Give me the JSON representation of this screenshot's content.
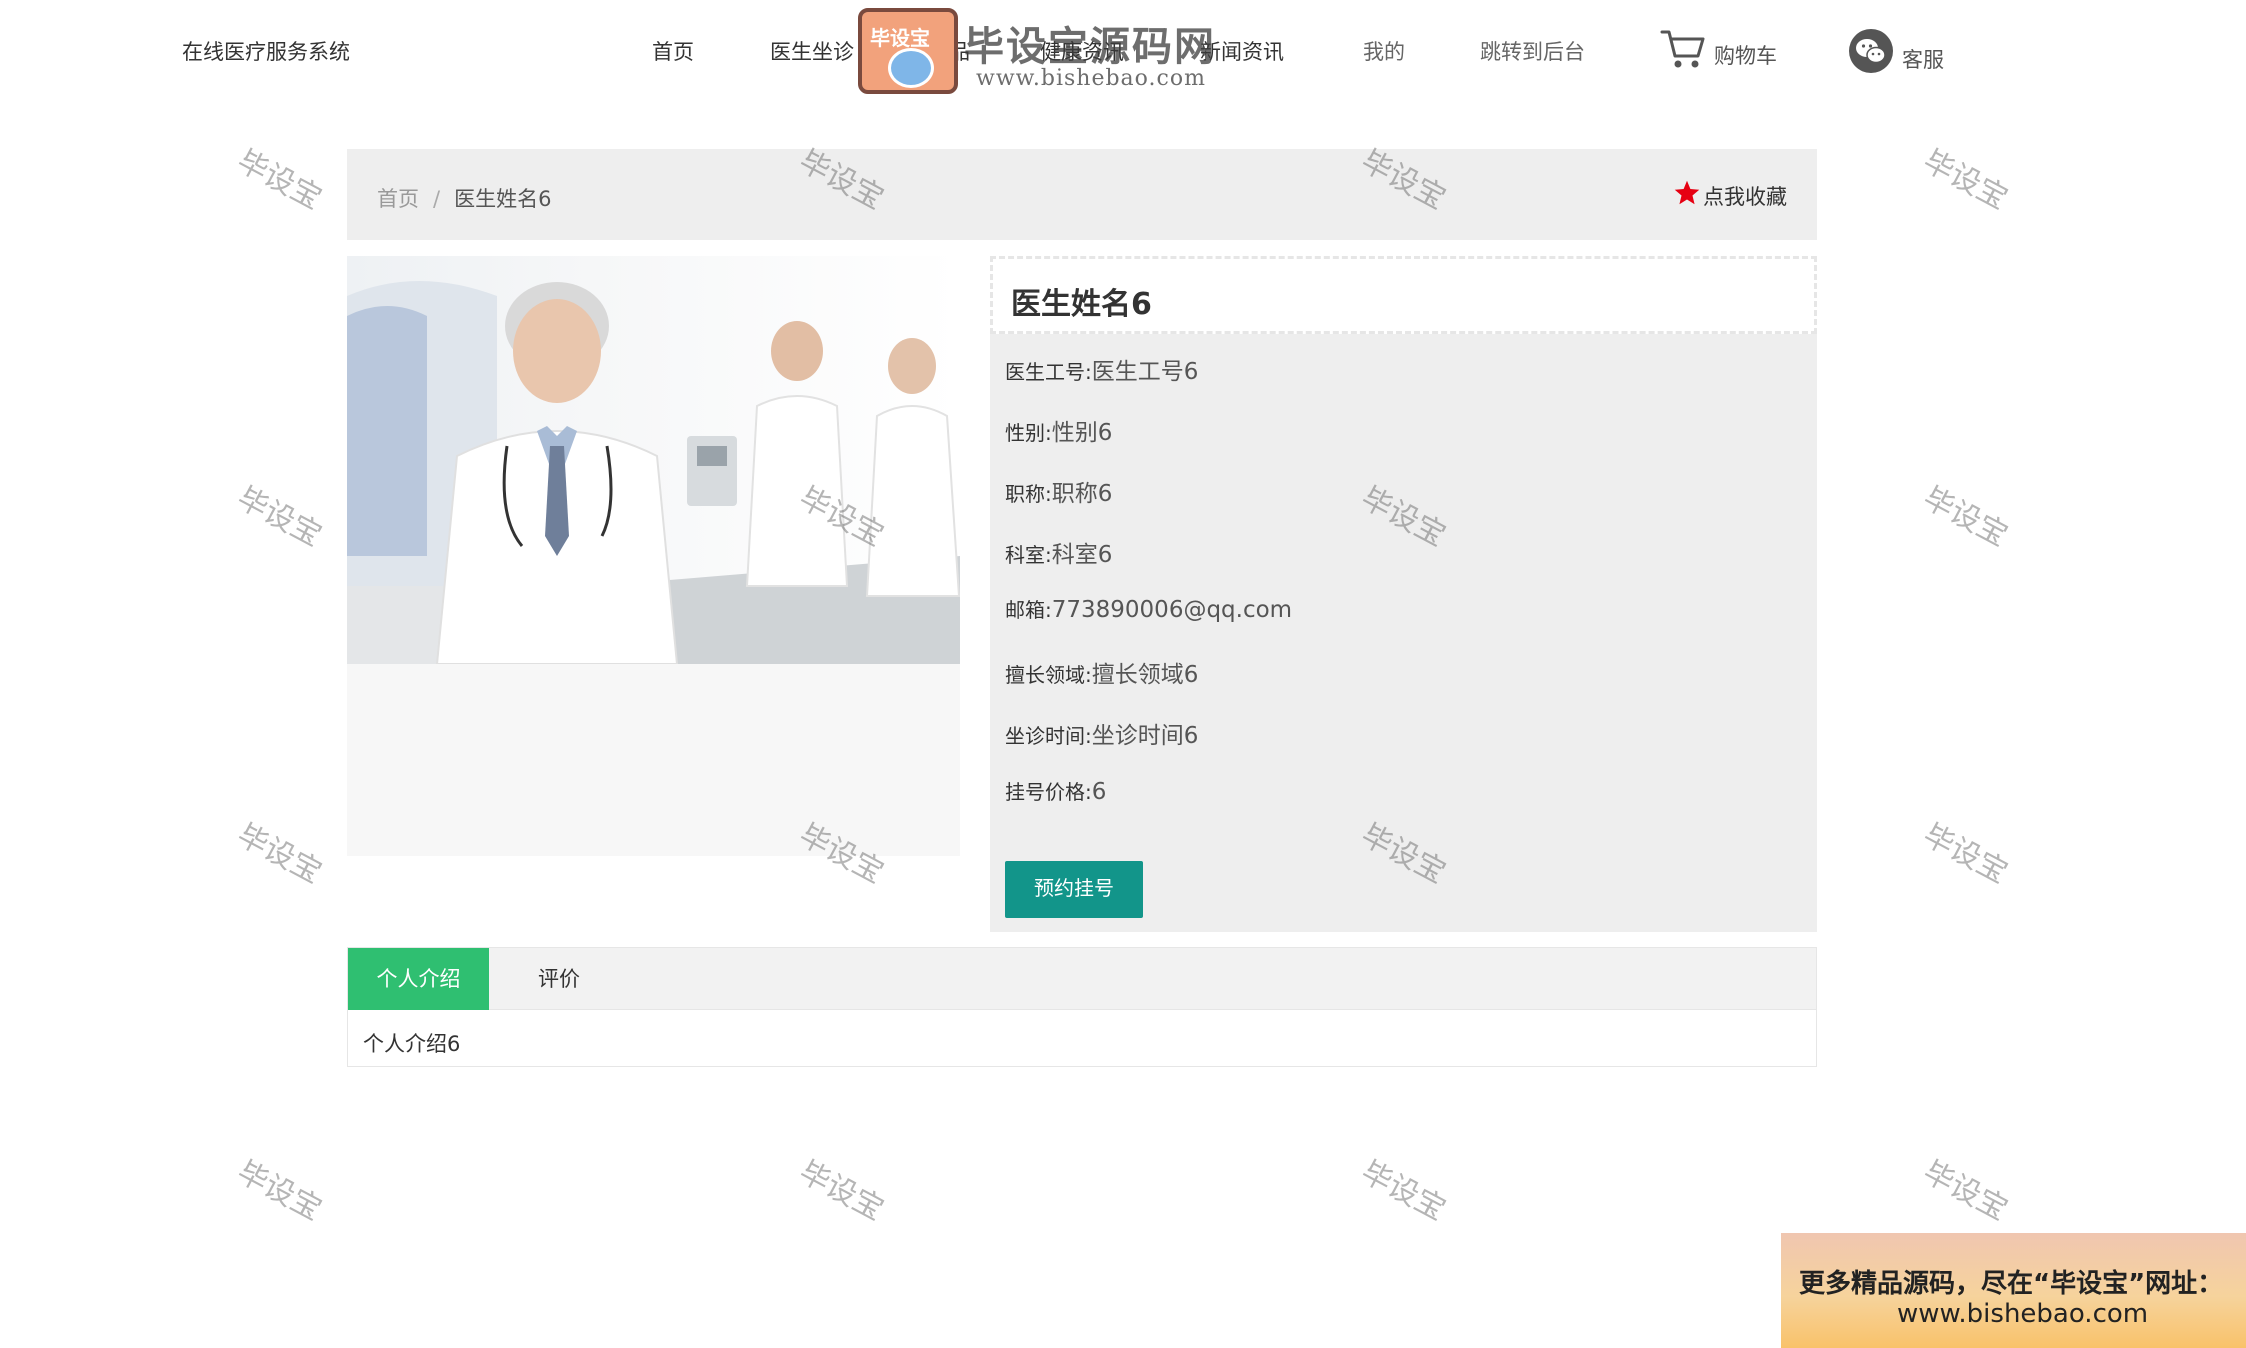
{
  "header": {
    "site_title": "在线医疗服务系统",
    "nav": [
      "首页",
      "医生坐诊",
      "药品",
      "健康资讯",
      "新闻资讯",
      "我的",
      "跳转到后台"
    ],
    "cart_label": "购物车",
    "service_label": "客服"
  },
  "brand_watermark": {
    "badge": "毕设宝",
    "name": "毕设宝源码网",
    "url": "www.bishebao.com"
  },
  "breadcrumb": {
    "home": "首页",
    "separator": "/",
    "current": "医生姓名6"
  },
  "favorite": {
    "label": "点我收藏",
    "icon": "star-icon",
    "color": "#e60012"
  },
  "doctor": {
    "name": "医生姓名6",
    "fields": [
      {
        "label": "医生工号:",
        "value": "医生工号6"
      },
      {
        "label": "性别:",
        "value": "性别6"
      },
      {
        "label": "职称:",
        "value": "职称6"
      },
      {
        "label": "科室:",
        "value": "科室6"
      },
      {
        "label": "邮箱:",
        "value": "773890006@qq.com"
      },
      {
        "label": "擅长领域:",
        "value": "擅长领域6"
      },
      {
        "label": "坐诊时间:",
        "value": "坐诊时间6"
      },
      {
        "label": "挂号价格:",
        "value": "6"
      }
    ],
    "book_button": "预约挂号",
    "book_button_color": "#12958a"
  },
  "tabs": {
    "items": [
      "个人介绍",
      "评价"
    ],
    "active_color": "#2fbf71",
    "content": "个人介绍6"
  },
  "watermark_text": "毕设宝",
  "promo": {
    "line1": "更多精品源码，尽在“毕设宝”网址：",
    "line2": "www.bishebao.com"
  }
}
